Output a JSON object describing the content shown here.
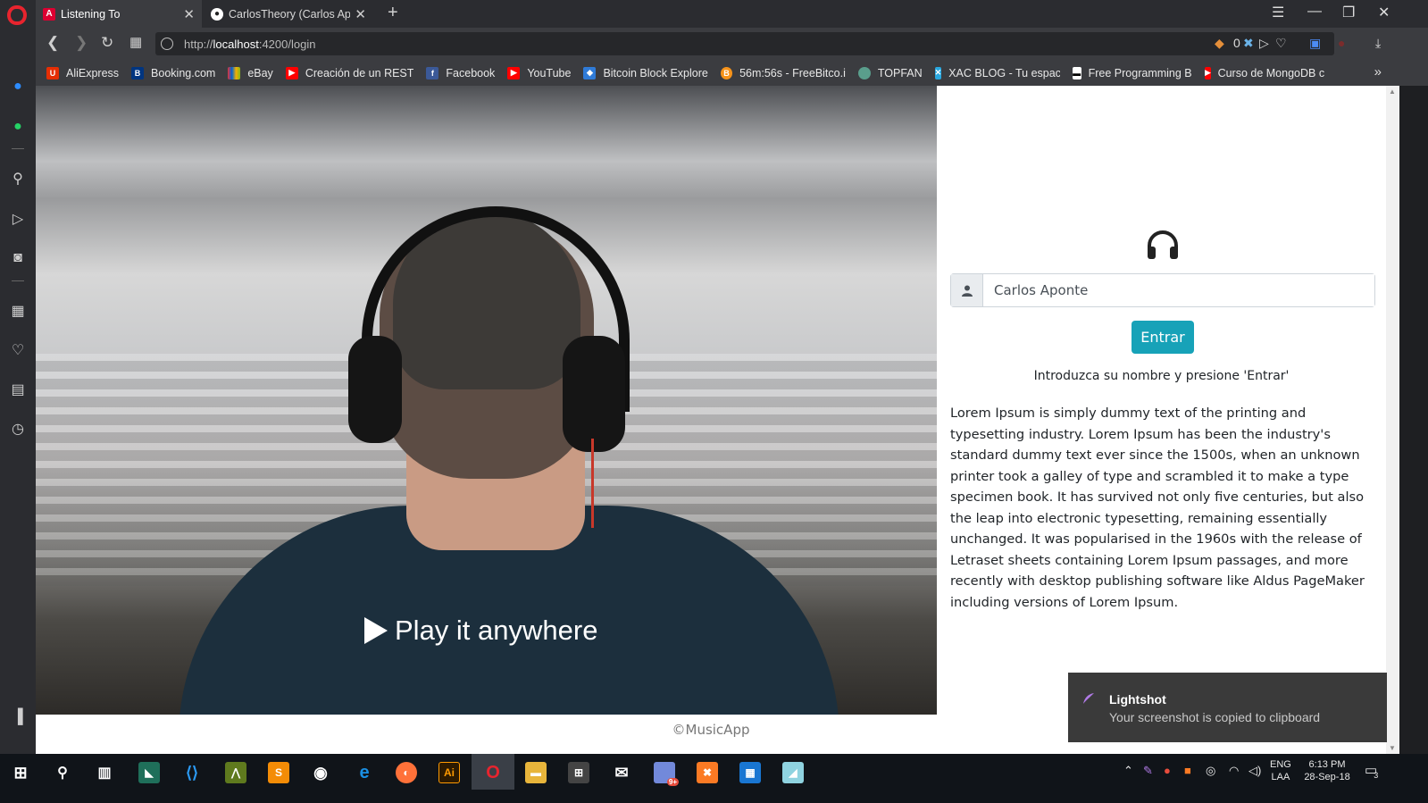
{
  "browser": {
    "tabs": [
      {
        "title": "Listening To",
        "favicon": "angular-icon",
        "color": "#dd0031",
        "active": true
      },
      {
        "title": "CarlosTheory (Carlos Apon",
        "favicon": "github-icon",
        "color": "#ffffff",
        "active": false
      }
    ],
    "url_prefix": "http://",
    "url_host": "localhost",
    "url_path": ":4200/login",
    "vpn_count": "0",
    "bookmarks": [
      {
        "label": "AliExpress",
        "icon": "aliexpress-icon",
        "color": "#e62e04"
      },
      {
        "label": "Booking.com",
        "icon": "booking-icon",
        "color": "#003580"
      },
      {
        "label": "eBay",
        "icon": "ebay-icon",
        "color": "#86b817"
      },
      {
        "label": "Creación de un REST",
        "icon": "youtube-icon",
        "color": "#ff0000"
      },
      {
        "label": "Facebook",
        "icon": "facebook-icon",
        "color": "#3b5998"
      },
      {
        "label": "YouTube",
        "icon": "youtube-icon",
        "color": "#ff0000"
      },
      {
        "label": "Bitcoin Block Explore",
        "icon": "blockchain-icon",
        "color": "#2f7bd8"
      },
      {
        "label": "56m:56s - FreeBitco.i",
        "icon": "bitcoin-icon",
        "color": "#f7931a"
      },
      {
        "label": "TOPFAN",
        "icon": "topfan-icon",
        "color": "#5a9e8c"
      },
      {
        "label": "XAC BLOG - Tu espac",
        "icon": "xac-icon",
        "color": "#29a8e0"
      },
      {
        "label": "Free Programming B",
        "icon": "book-icon",
        "color": "#ffffff"
      },
      {
        "label": "Curso de MongoDB c",
        "icon": "youtube-icon",
        "color": "#ff0000"
      }
    ]
  },
  "hero": {
    "tagline": "Play it anywhere"
  },
  "login": {
    "username_value": "Carlos Aponte",
    "submit_label": "Entrar",
    "hint": "Introduzca su nombre y presione 'Entrar'",
    "description": "Lorem Ipsum is simply dummy text of the printing and typesetting industry. Lorem Ipsum has been the industry's standard dummy text ever since the 1500s, when an unknown printer took a galley of type and scrambled it to make a type specimen book. It has survived not only five centuries, but also the leap into electronic typesetting, remaining essentially unchanged. It was popularised in the 1960s with the release of Letraset sheets containing Lorem Ipsum passages, and more recently with desktop publishing software like Aldus PageMaker including versions of Lorem Ipsum.",
    "accent_color": "#17a2b8"
  },
  "footer": {
    "text": "©MusicApp"
  },
  "notification": {
    "app": "Lightshot",
    "message": "Your screenshot is copied to clipboard"
  },
  "taskbar": {
    "lang_top": "ENG",
    "lang_bottom": "LAA",
    "time": "6:13 PM",
    "date": "28-Sep-18",
    "notif_count": "3",
    "chat_badge": "9+"
  }
}
